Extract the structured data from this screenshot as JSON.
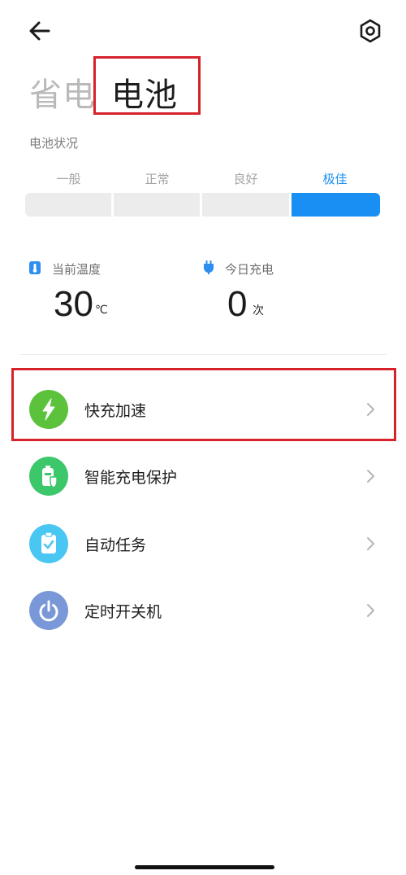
{
  "header": {
    "tabs": [
      {
        "label": "省电",
        "active": false
      },
      {
        "label": "电池",
        "active": true
      }
    ]
  },
  "battery_status": {
    "label": "电池状况",
    "levels": [
      "一般",
      "正常",
      "良好",
      "极佳"
    ],
    "current_level": "极佳"
  },
  "stats": {
    "temperature": {
      "label": "当前温度",
      "value": "30",
      "unit": "℃"
    },
    "charges_today": {
      "label": "今日充电",
      "value": "0",
      "unit": "次"
    }
  },
  "menu": [
    {
      "label": "快充加速",
      "icon": "lightning-icon",
      "color": "#5cc23b"
    },
    {
      "label": "智能充电保护",
      "icon": "battery-shield-icon",
      "color": "#3dc76b"
    },
    {
      "label": "自动任务",
      "icon": "clipboard-check-icon",
      "color": "#49c6f2"
    },
    {
      "label": "定时开关机",
      "icon": "power-icon",
      "color": "#7a98d8"
    }
  ],
  "colors": {
    "accent": "#1a8ff3",
    "highlight_box": "#d6232b"
  }
}
